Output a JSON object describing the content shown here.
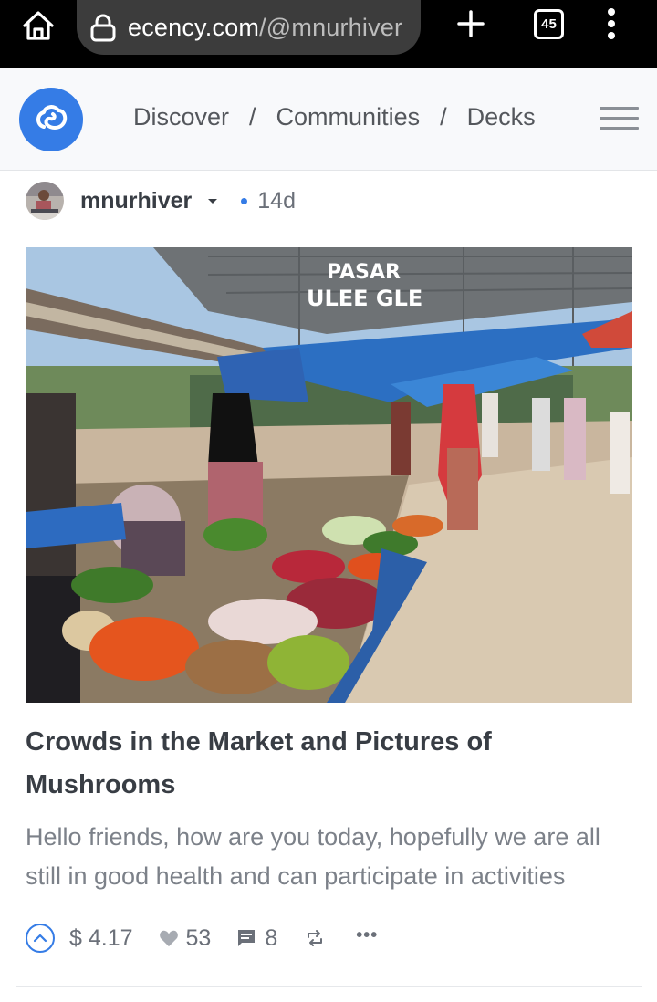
{
  "browser": {
    "url_host": "ecency.com",
    "url_path": "/@mnurhiver",
    "tab_count": "45"
  },
  "header": {
    "nav": [
      "Discover",
      "Communities",
      "Decks"
    ]
  },
  "post": {
    "author": "mnurhiver",
    "age": "14d",
    "image_sign_line1": "PASAR",
    "image_sign_line2": "ULEE GLE",
    "title": "Crowds in the Market and Pictures of Mushrooms",
    "summary": "Hello friends, how are you today, hopefully we are all still in good health and can participate in activities",
    "payout": "$ 4.17",
    "likes": "53",
    "comments": "8"
  },
  "colors": {
    "brand": "#357ce6",
    "chrome": "#000000",
    "header_bg": "#f8f9fb"
  }
}
